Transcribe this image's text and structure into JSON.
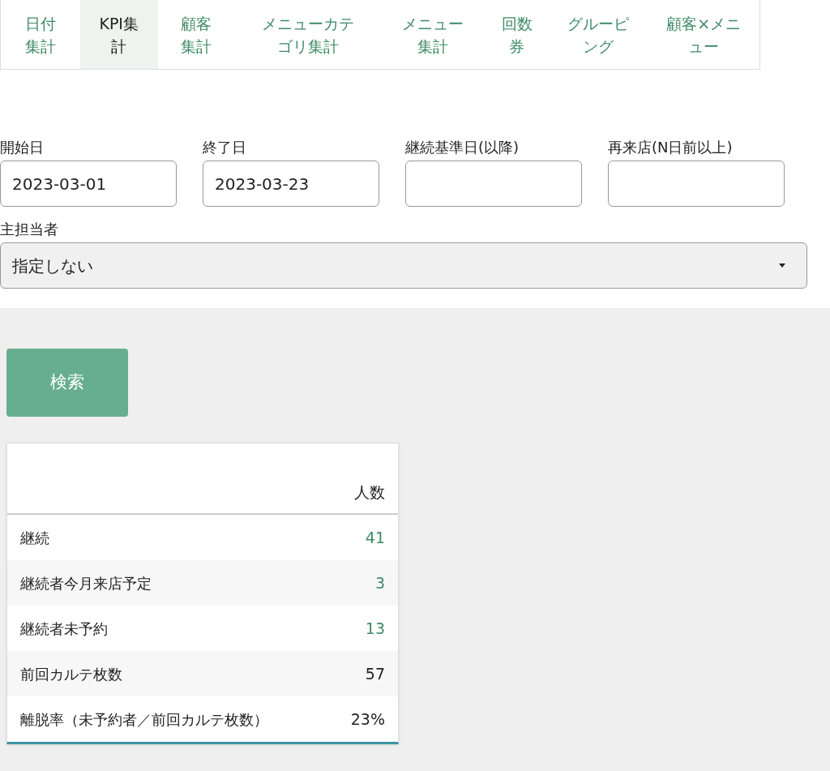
{
  "tabs": [
    {
      "label": "日付集計",
      "selected": false
    },
    {
      "label": "KPI集計",
      "selected": true
    },
    {
      "label": "顧客集計",
      "selected": false
    },
    {
      "label": "メニューカテゴリ集計",
      "selected": false
    },
    {
      "label": "メニュー集計",
      "selected": false
    },
    {
      "label": "回数券",
      "selected": false
    },
    {
      "label": "グルーピング",
      "selected": false
    },
    {
      "label": "顧客×メニュー",
      "selected": false
    }
  ],
  "filters": [
    {
      "label": "開始日",
      "value": "2023-03-01"
    },
    {
      "label": "終了日",
      "value": "2023-03-23"
    },
    {
      "label": "継続基準日(以降)"
    },
    {
      "label": "再来店(N日前以上)"
    }
  ],
  "staff_select": {
    "label": "主担当者",
    "value": "指定しない"
  },
  "search_button": "検索",
  "table": {
    "column_header": "人数",
    "rows": [
      {
        "label": "継続",
        "value": "41",
        "linked": true
      },
      {
        "label": "継続者今月来店予定",
        "value": "3",
        "linked": true
      },
      {
        "label": "継続者未予約",
        "value": "13",
        "linked": true
      },
      {
        "label": "前回カルテ枚数",
        "value": "57",
        "linked": false
      },
      {
        "label": "離脱率（未予約者／前回カルテ枚数）",
        "value": "23%",
        "linked": false
      }
    ]
  }
}
